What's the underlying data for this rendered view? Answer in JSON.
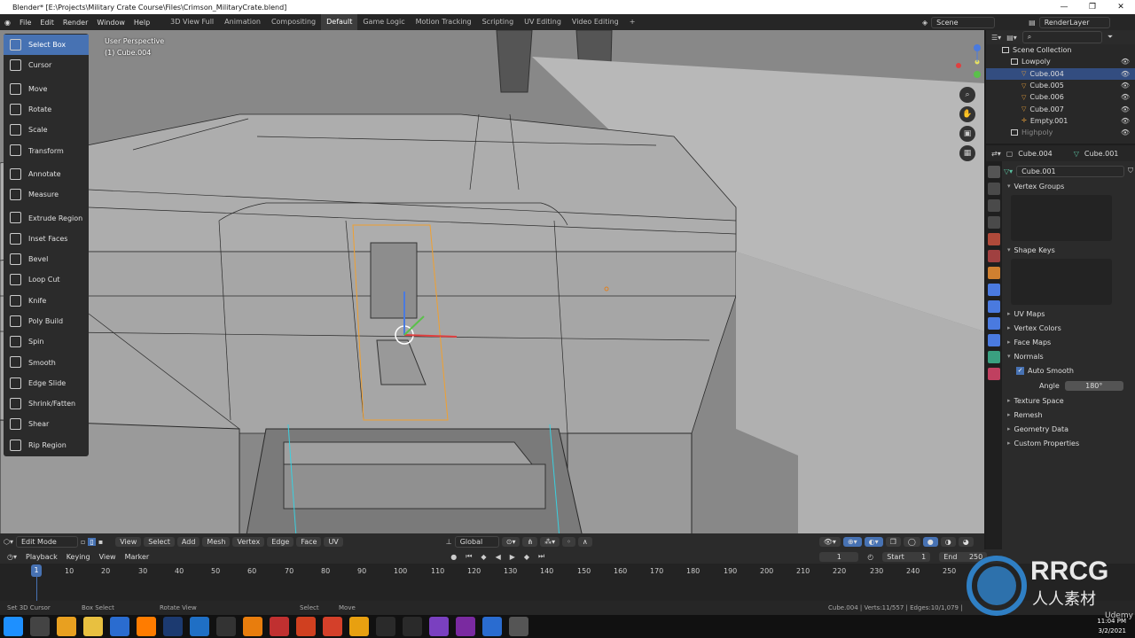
{
  "window": {
    "title": "Blender* [E:\\Projects\\Military Crate Course\\Files\\Crimson_MilitaryCrate.blend]",
    "controls": [
      "—",
      "❐",
      "✕"
    ]
  },
  "menu": [
    "File",
    "Edit",
    "Render",
    "Window",
    "Help"
  ],
  "workspaces": [
    "3D View Full",
    "Animation",
    "Compositing",
    "Default",
    "Game Logic",
    "Motion Tracking",
    "Scripting",
    "UV Editing",
    "Video Editing",
    "+"
  ],
  "active_workspace": "Default",
  "scene": {
    "label": "Scene",
    "render_layer": "RenderLayer"
  },
  "viewport": {
    "info_line1": "User Perspective",
    "info_line2": "(1) Cube.004"
  },
  "tools": [
    {
      "label": "Select Box",
      "icon": "select-box-icon",
      "selected": true
    },
    {
      "label": "Cursor",
      "icon": "cursor-icon"
    },
    {
      "label": "Move",
      "icon": "move-icon",
      "gap": true
    },
    {
      "label": "Rotate",
      "icon": "rotate-icon"
    },
    {
      "label": "Scale",
      "icon": "scale-icon"
    },
    {
      "label": "Transform",
      "icon": "transform-icon"
    },
    {
      "label": "Annotate",
      "icon": "annotate-icon",
      "gap": true
    },
    {
      "label": "Measure",
      "icon": "measure-icon"
    },
    {
      "label": "Extrude Region",
      "icon": "extrude-icon",
      "gap": true
    },
    {
      "label": "Inset Faces",
      "icon": "inset-icon"
    },
    {
      "label": "Bevel",
      "icon": "bevel-icon"
    },
    {
      "label": "Loop Cut",
      "icon": "loop-cut-icon"
    },
    {
      "label": "Knife",
      "icon": "knife-icon"
    },
    {
      "label": "Poly Build",
      "icon": "poly-build-icon"
    },
    {
      "label": "Spin",
      "icon": "spin-icon"
    },
    {
      "label": "Smooth",
      "icon": "smooth-icon"
    },
    {
      "label": "Edge Slide",
      "icon": "edge-slide-icon"
    },
    {
      "label": "Shrink/Fatten",
      "icon": "shrink-icon"
    },
    {
      "label": "Shear",
      "icon": "shear-icon"
    },
    {
      "label": "Rip Region",
      "icon": "rip-icon"
    }
  ],
  "viewport_header": {
    "mode": "Edit Mode",
    "menus": [
      "View",
      "Select",
      "Add",
      "Mesh",
      "Vertex",
      "Edge",
      "Face",
      "UV"
    ],
    "orientation": "Global"
  },
  "outliner": {
    "root": "Scene Collection",
    "rows": [
      {
        "name": "Lowpoly",
        "kind": "collection"
      },
      {
        "name": "Cube.004",
        "kind": "mesh",
        "active": true
      },
      {
        "name": "Cube.005",
        "kind": "mesh"
      },
      {
        "name": "Cube.006",
        "kind": "mesh"
      },
      {
        "name": "Cube.007",
        "kind": "mesh"
      },
      {
        "name": "Empty.001",
        "kind": "empty"
      },
      {
        "name": "Highpoly",
        "kind": "collection"
      }
    ]
  },
  "properties": {
    "object": "Cube.004",
    "data": "Cube.001",
    "data_field": "Cube.001",
    "sections_open": [
      "Vertex Groups",
      "Shape Keys"
    ],
    "sections": [
      "UV Maps",
      "Vertex Colors",
      "Face Maps",
      "Normals"
    ],
    "auto_smooth_label": "Auto Smooth",
    "angle_label": "Angle",
    "angle_value": "180°",
    "sections_after": [
      "Texture Space",
      "Remesh",
      "Geometry Data",
      "Custom Properties"
    ]
  },
  "timeline": {
    "menus": [
      "Playback",
      "Keying",
      "View",
      "Marker"
    ],
    "current_frame": "1",
    "start_label": "Start",
    "start": "1",
    "end_label": "End",
    "end": "250",
    "ticks": [
      "1",
      "10",
      "20",
      "30",
      "40",
      "50",
      "60",
      "70",
      "80",
      "90",
      "100",
      "110",
      "120",
      "130",
      "140",
      "150",
      "160",
      "170",
      "180",
      "190",
      "200",
      "210",
      "220",
      "230",
      "240",
      "250"
    ]
  },
  "status": {
    "left": [
      "Set 3D Cursor",
      "Box Select",
      "Rotate View",
      "Select",
      "Move"
    ],
    "stats": "Cube.004 | Verts:11/557 | Edges:10/1,079 |"
  },
  "taskbar": {
    "time": "11:04 PM",
    "date": "3/2/2021",
    "apps": [
      "windows-icon",
      "search-icon",
      "chrome-icon",
      "explorer-icon",
      "app-icon",
      "illustrator-icon",
      "photoshop-icon",
      "vscode-icon",
      "epic-icon",
      "blender-icon",
      "app2-icon",
      "app3-icon",
      "substance-icon",
      "marmoset-icon",
      "app4-icon",
      "app5-icon",
      "app6-icon",
      "onenote-icon",
      "app7-icon",
      "settings-icon"
    ]
  },
  "watermark": {
    "brand": "RRCG",
    "sub": "人人素材",
    "udemy": "Udemy"
  },
  "colors": {
    "accent": "#4772b3",
    "orange": "#e09b38",
    "selected_edge": "#f0a030"
  }
}
